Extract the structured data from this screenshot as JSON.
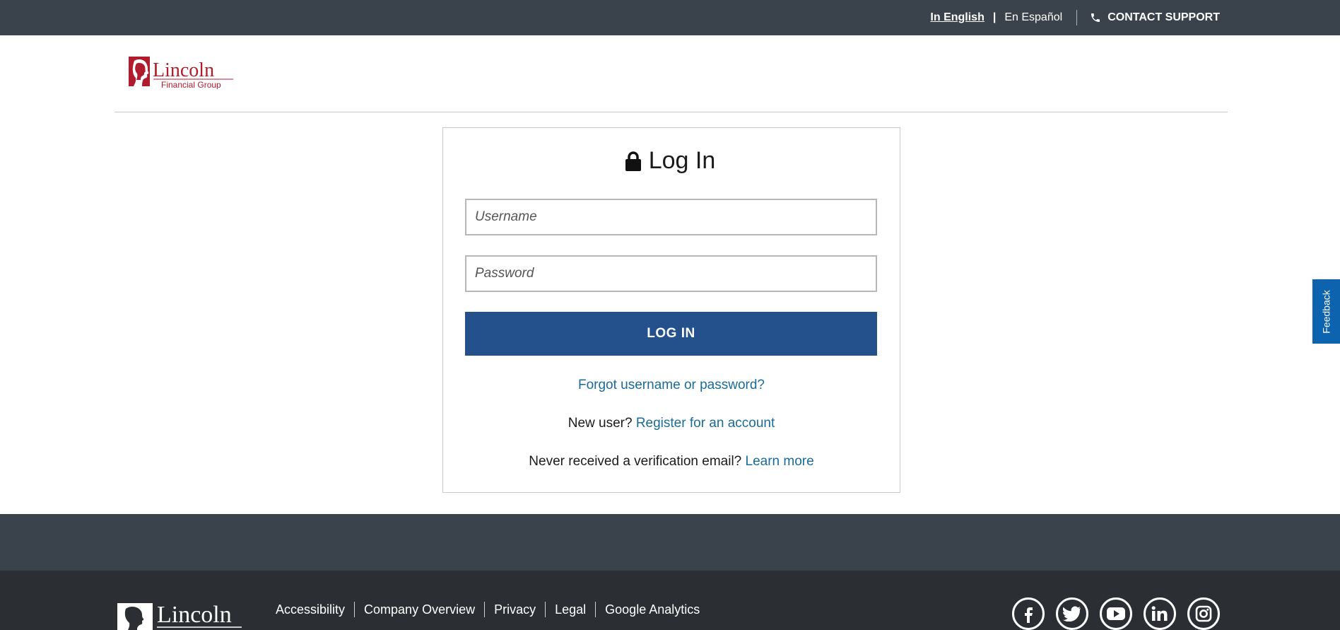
{
  "topbar": {
    "lang_english": "In English",
    "lang_separator": "|",
    "lang_spanish": "En Español",
    "contact_support": "CONTACT SUPPORT"
  },
  "brand": {
    "name": "Lincoln",
    "subtitle": "Financial Group",
    "color": "#b01c2e"
  },
  "login": {
    "title": "Log In",
    "username_placeholder": "Username",
    "password_placeholder": "Password",
    "button_label": "LOG IN",
    "forgot_link": "Forgot username or password?",
    "new_user_text": "New user?",
    "register_link": "Register for an account",
    "verification_text": "Never received a verification email?",
    "learn_more_link": "Learn more",
    "button_color": "#24508c",
    "link_color": "#1a6b98"
  },
  "feedback": {
    "label": "Feedback",
    "color": "#0d63ae"
  },
  "footer": {
    "brand_name": "Lincoln",
    "links": [
      "Accessibility",
      "Company Overview",
      "Privacy",
      "Legal",
      "Google Analytics"
    ],
    "social": [
      {
        "name": "facebook-icon",
        "glyph": "f"
      },
      {
        "name": "twitter-icon",
        "glyph": "t"
      },
      {
        "name": "youtube-icon",
        "glyph": "▶"
      },
      {
        "name": "linkedin-icon",
        "glyph": "in"
      },
      {
        "name": "instagram-icon",
        "glyph": "◎"
      }
    ]
  }
}
